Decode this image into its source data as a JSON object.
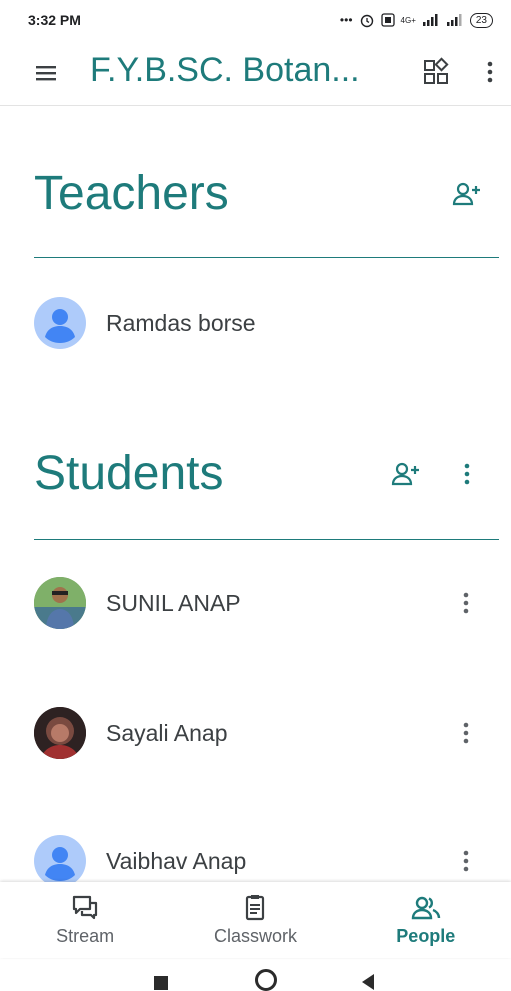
{
  "status_bar": {
    "time": "3:32 PM",
    "signal_text": "4G+",
    "battery": "23"
  },
  "app_bar": {
    "title": "F.Y.B.SC. Botan..."
  },
  "teachers": {
    "heading": "Teachers",
    "people": [
      {
        "name": "Ramdas borse"
      }
    ]
  },
  "students": {
    "heading": "Students",
    "people": [
      {
        "name": "SUNIL ANAP"
      },
      {
        "name": "Sayali Anap"
      },
      {
        "name": "Vaibhav Anap"
      }
    ]
  },
  "bottom_nav": {
    "items": [
      {
        "label": "Stream",
        "icon": "stream-icon"
      },
      {
        "label": "Classwork",
        "icon": "classwork-icon"
      },
      {
        "label": "People",
        "icon": "people-icon",
        "active": true
      }
    ]
  },
  "colors": {
    "accent": "#1e7b7b",
    "avatar_default": "#aecbfa",
    "avatar_glyph": "#4285f4",
    "text": "#3c4043"
  }
}
